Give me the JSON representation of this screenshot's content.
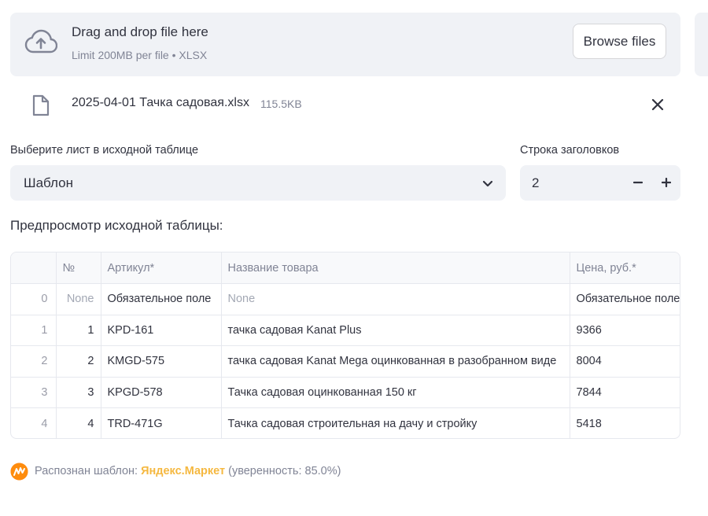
{
  "uploader": {
    "title": "Drag and drop file here",
    "limit": "Limit 200MB per file • XLSX",
    "browse_label": "Browse files"
  },
  "file": {
    "name": "2025-04-01 Тачка садовая.xlsx",
    "size": "115.5KB"
  },
  "sheet_select": {
    "label": "Выберите лист в исходной таблице",
    "value": "Шаблон"
  },
  "header_row": {
    "label": "Строка заголовков",
    "value": "2",
    "minus": "−",
    "plus": "+"
  },
  "preview": {
    "title": "Предпросмотр исходной таблицы:",
    "columns": [
      "",
      "№",
      "Артикул*",
      "Название товара",
      "Цена, руб.*"
    ],
    "rows": [
      [
        "0",
        "None",
        "Обязательное поле",
        "None",
        "Обязательное поле"
      ],
      [
        "1",
        "1",
        "KPD-161",
        "тачка садовая Kanat Plus",
        "9366"
      ],
      [
        "2",
        "2",
        "KMGD-575",
        "тачка садовая Kanat Mega оцинкованная в разобранном виде",
        "8004"
      ],
      [
        "3",
        "3",
        "KPGD-578",
        "Тачка садовая оцинкованная 150 кг",
        "7844"
      ],
      [
        "4",
        "4",
        "TRD-471G",
        "Тачка садовая строительная на дачу и стройку",
        "5418"
      ]
    ]
  },
  "status": {
    "prefix": "Распознан шаблон:",
    "brand": "Яндекс.Маркет",
    "suffix": "(уверенность: 85.0%)",
    "brand_color": "#f5b840",
    "logo_icon": "yandex-market-logo"
  }
}
